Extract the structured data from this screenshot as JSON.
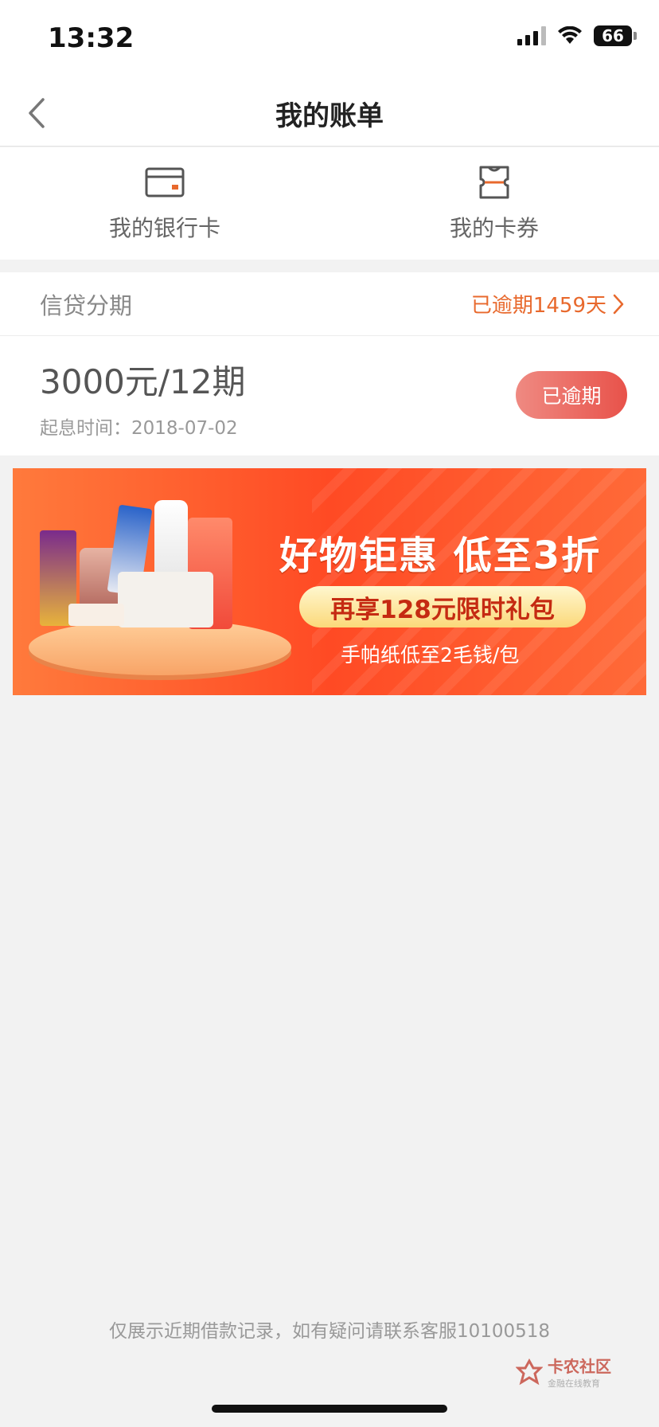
{
  "status_bar": {
    "time": "13:32",
    "battery": "66"
  },
  "nav": {
    "title": "我的账单"
  },
  "quick_links": [
    {
      "label": "我的银行卡",
      "icon": "bank-card-icon"
    },
    {
      "label": "我的卡券",
      "icon": "coupon-icon"
    }
  ],
  "credit": {
    "title": "信贷分期",
    "overdue_link": "已逾期1459天",
    "loan": {
      "amount": "3000元/12期",
      "date_label": "起息时间：",
      "date": "2018-07-02",
      "status_button": "已逾期"
    }
  },
  "banner": {
    "headline": "好物钜惠  低至3折",
    "pill": "再享128元限时礼包",
    "sub": "手帕纸低至2毛钱/包"
  },
  "footer": {
    "note": "仅展示近期借款记录，如有疑问请联系客服10100518"
  },
  "watermark": {
    "title": "卡农社区",
    "sub": "金融在线教育"
  },
  "colors": {
    "accent": "#e8692d",
    "overdue_button": "#e8524a",
    "icon_orange": "#e8692d"
  }
}
